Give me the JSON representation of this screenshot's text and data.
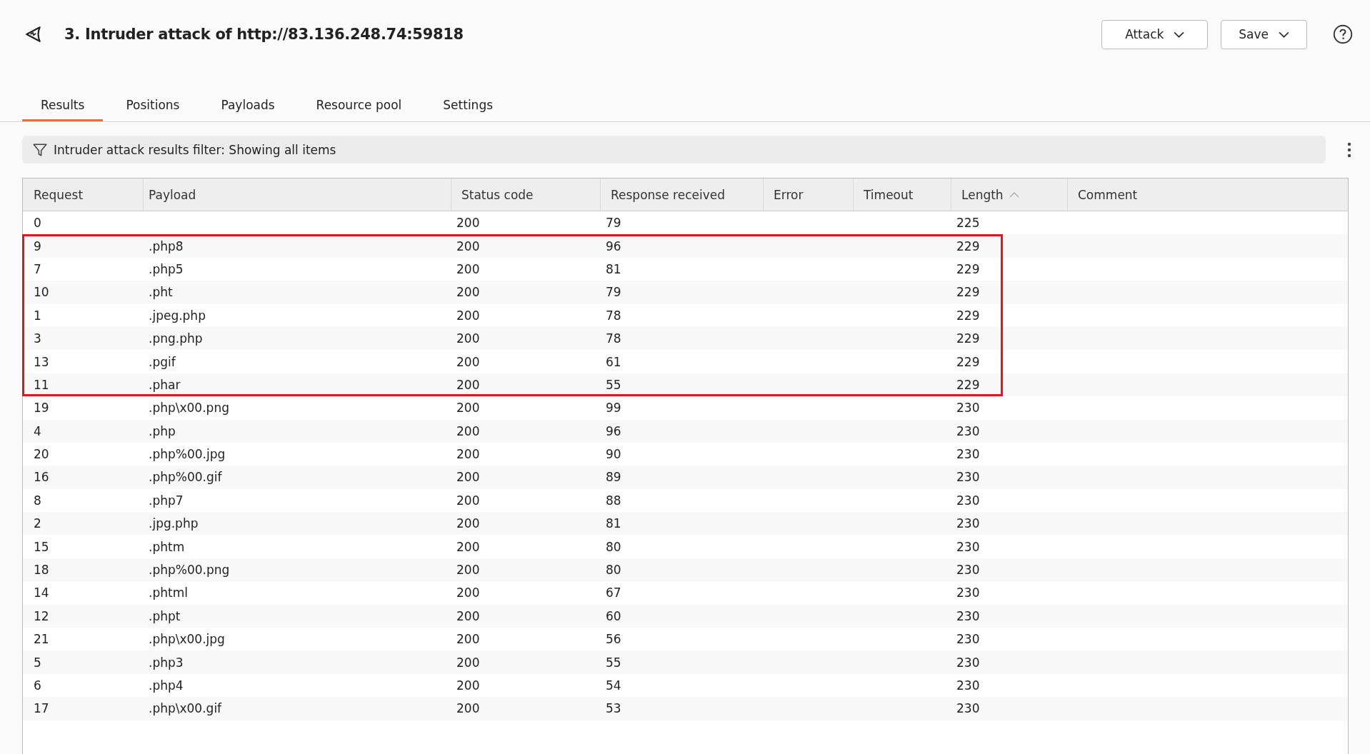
{
  "window": {
    "title": "3. Intruder attack of http://83.136.248.74:59818"
  },
  "buttons": [
    {
      "label": "Attack",
      "kind": "dropdown"
    },
    {
      "label": "Save",
      "kind": "dropdown"
    }
  ],
  "tabs": [
    {
      "label": "Results",
      "selected": true
    },
    {
      "label": "Positions",
      "selected": false
    },
    {
      "label": "Payloads",
      "selected": false
    },
    {
      "label": "Resource pool",
      "selected": false
    },
    {
      "label": "Settings",
      "selected": false
    }
  ],
  "filter": {
    "text": "Intruder attack results filter: Showing all items"
  },
  "table": {
    "columns": [
      {
        "label": "Request",
        "sorted": false
      },
      {
        "label": "Payload",
        "sorted": false
      },
      {
        "label": "Status code",
        "sorted": false
      },
      {
        "label": "Response received",
        "sorted": false
      },
      {
        "label": "Error",
        "sorted": false
      },
      {
        "label": "Timeout",
        "sorted": false
      },
      {
        "label": "Length",
        "sorted": true
      },
      {
        "label": "Comment",
        "sorted": false
      }
    ],
    "rows": [
      {
        "cells": [
          "0",
          "",
          "200",
          "79",
          "",
          "",
          "225",
          ""
        ],
        "highlighted": false
      },
      {
        "cells": [
          "9",
          ".php8",
          "200",
          "96",
          "",
          "",
          "229",
          ""
        ],
        "highlighted": true
      },
      {
        "cells": [
          "7",
          ".php5",
          "200",
          "81",
          "",
          "",
          "229",
          ""
        ],
        "highlighted": true
      },
      {
        "cells": [
          "10",
          ".pht",
          "200",
          "79",
          "",
          "",
          "229",
          ""
        ],
        "highlighted": true
      },
      {
        "cells": [
          "1",
          ".jpeg.php",
          "200",
          "78",
          "",
          "",
          "229",
          ""
        ],
        "highlighted": true
      },
      {
        "cells": [
          "3",
          ".png.php",
          "200",
          "78",
          "",
          "",
          "229",
          ""
        ],
        "highlighted": true
      },
      {
        "cells": [
          "13",
          ".pgif",
          "200",
          "61",
          "",
          "",
          "229",
          ""
        ],
        "highlighted": true
      },
      {
        "cells": [
          "11",
          ".phar",
          "200",
          "55",
          "",
          "",
          "229",
          ""
        ],
        "highlighted": true
      },
      {
        "cells": [
          "19",
          ".php\\x00.png",
          "200",
          "99",
          "",
          "",
          "230",
          ""
        ],
        "highlighted": false
      },
      {
        "cells": [
          "4",
          ".php",
          "200",
          "96",
          "",
          "",
          "230",
          ""
        ],
        "highlighted": false
      },
      {
        "cells": [
          "20",
          ".php%00.jpg",
          "200",
          "90",
          "",
          "",
          "230",
          ""
        ],
        "highlighted": false
      },
      {
        "cells": [
          "16",
          ".php%00.gif",
          "200",
          "89",
          "",
          "",
          "230",
          ""
        ],
        "highlighted": false
      },
      {
        "cells": [
          "8",
          ".php7",
          "200",
          "88",
          "",
          "",
          "230",
          ""
        ],
        "highlighted": false
      },
      {
        "cells": [
          "2",
          ".jpg.php",
          "200",
          "81",
          "",
          "",
          "230",
          ""
        ],
        "highlighted": false
      },
      {
        "cells": [
          "15",
          ".phtm",
          "200",
          "80",
          "",
          "",
          "230",
          ""
        ],
        "highlighted": false
      },
      {
        "cells": [
          "18",
          ".php%00.png",
          "200",
          "80",
          "",
          "",
          "230",
          ""
        ],
        "highlighted": false
      },
      {
        "cells": [
          "14",
          ".phtml",
          "200",
          "67",
          "",
          "",
          "230",
          ""
        ],
        "highlighted": false
      },
      {
        "cells": [
          "12",
          ".phpt",
          "200",
          "60",
          "",
          "",
          "230",
          ""
        ],
        "highlighted": false
      },
      {
        "cells": [
          "21",
          ".php\\x00.jpg",
          "200",
          "56",
          "",
          "",
          "230",
          ""
        ],
        "highlighted": false
      },
      {
        "cells": [
          "5",
          ".php3",
          "200",
          "55",
          "",
          "",
          "230",
          ""
        ],
        "highlighted": false
      },
      {
        "cells": [
          "6",
          ".php4",
          "200",
          "54",
          "",
          "",
          "230",
          ""
        ],
        "highlighted": false
      },
      {
        "cells": [
          "17",
          ".php\\x00.gif",
          "200",
          "53",
          "",
          "",
          "230",
          ""
        ],
        "highlighted": false
      }
    ]
  }
}
